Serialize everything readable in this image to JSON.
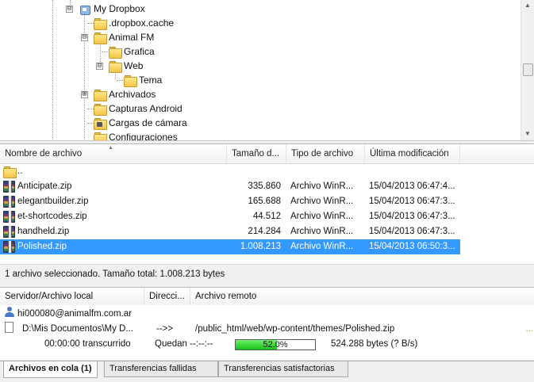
{
  "tree": {
    "items": [
      {
        "label": "My Dropbox"
      },
      {
        "label": ".dropbox.cache"
      },
      {
        "label": "Animal FM"
      },
      {
        "label": "Grafica"
      },
      {
        "label": "Web"
      },
      {
        "label": "Tema"
      },
      {
        "label": "Archivados"
      },
      {
        "label": "Capturas Android"
      },
      {
        "label": "Cargas de cámara"
      },
      {
        "label": "Configuraciones"
      }
    ],
    "expander_open": "⊟",
    "expander_closed": "⊞"
  },
  "filelist": {
    "headers": {
      "name": "Nombre de archivo",
      "size": "Tamaño d...",
      "type": "Tipo de archivo",
      "modified": "Última modificación"
    },
    "up": "..",
    "rows": [
      {
        "name": "Anticipate.zip",
        "size": "335.860",
        "type": "Archivo WinR...",
        "modified": "15/04/2013 06:47:4..."
      },
      {
        "name": "elegantbuilder.zip",
        "size": "165.688",
        "type": "Archivo WinR...",
        "modified": "15/04/2013 06:47:3..."
      },
      {
        "name": "et-shortcodes.zip",
        "size": "44.512",
        "type": "Archivo WinR...",
        "modified": "15/04/2013 06:47:3..."
      },
      {
        "name": "handheld.zip",
        "size": "214.284",
        "type": "Archivo WinR...",
        "modified": "15/04/2013 06:47:3..."
      },
      {
        "name": "Polished.zip",
        "size": "1.008.213",
        "type": "Archivo WinR...",
        "modified": "15/04/2013 06:50:3...",
        "selected": true
      }
    ]
  },
  "status": "1 archivo seleccionado. Tamaño total: 1.008.213 bytes",
  "queue": {
    "headers": {
      "server_local": "Servidor/Archivo local",
      "direction": "Direcci...",
      "remote": "Archivo remoto"
    },
    "server": "hi000080@animalfm.com.ar",
    "local_file": "D:\\Mis Documentos\\My D...",
    "direction": "-->>",
    "remote_file": "/public_html/web/wp-content/themes/Polished.zip",
    "elapsed": "00:00:00 transcurrido",
    "remaining": "Quedan --:--:--",
    "progress_percent": 52.0,
    "progress_label": "52.0%",
    "transferred": "524.288 bytes (? B/s)",
    "marker": "…"
  },
  "tabs": [
    {
      "label": "Archivos en cola (1)",
      "active": true
    },
    {
      "label": "Transferencias fallidas"
    },
    {
      "label": "Transferencias satisfactorias"
    }
  ],
  "colors": {
    "selection": "#3399ff",
    "progress": "#22cc22"
  }
}
